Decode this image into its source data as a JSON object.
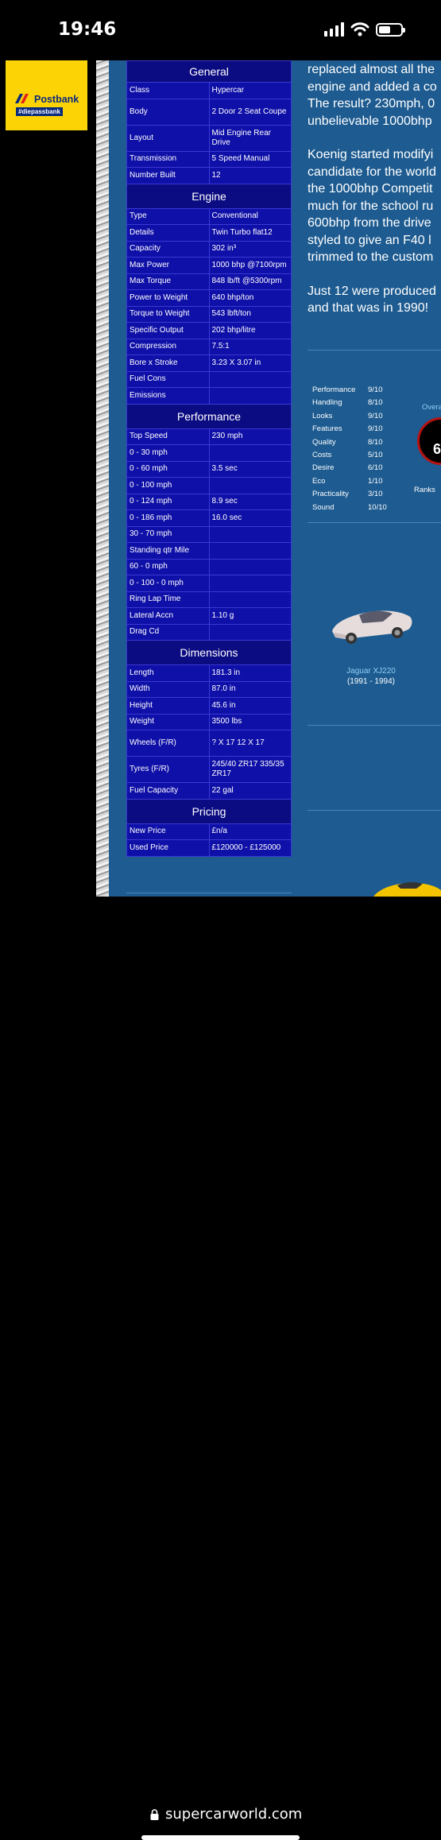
{
  "status": {
    "time": "19:46"
  },
  "ad": {
    "brand": "Postbank",
    "tagline": "#diepassbank"
  },
  "spec_sections": [
    {
      "title": "General",
      "rows": [
        [
          "Class",
          "Hypercar"
        ],
        [
          "Body",
          "2 Door 2 Seat Coupe"
        ],
        [
          "Layout",
          "Mid Engine Rear Drive"
        ],
        [
          "Transmission",
          "5 Speed Manual"
        ],
        [
          "Number Built",
          "12"
        ]
      ]
    },
    {
      "title": "Engine",
      "rows": [
        [
          "Type",
          "Conventional"
        ],
        [
          "Details",
          "Twin Turbo flat12"
        ],
        [
          "Capacity",
          "302 in³"
        ],
        [
          "Max Power",
          "1000 bhp @7100rpm"
        ],
        [
          "Max Torque",
          "848 lb/ft @5300rpm"
        ],
        [
          "Power to Weight",
          "640 bhp/ton"
        ],
        [
          "Torque to Weight",
          "543 lbft/ton"
        ],
        [
          "Specific Output",
          "202 bhp/litre"
        ],
        [
          "Compression",
          "7.5:1"
        ],
        [
          "Bore x Stroke",
          "3.23 X 3.07 in"
        ],
        [
          "Fuel Cons",
          ""
        ],
        [
          "Emissions",
          ""
        ]
      ]
    },
    {
      "title": "Performance",
      "rows": [
        [
          "Top Speed",
          "230 mph"
        ],
        [
          "0 - 30 mph",
          ""
        ],
        [
          "0 - 60 mph",
          "3.5 sec"
        ],
        [
          "0 - 100 mph",
          ""
        ],
        [
          "0 - 124 mph",
          "8.9 sec"
        ],
        [
          "0 - 186 mph",
          "16.0 sec"
        ],
        [
          "30 - 70 mph",
          ""
        ],
        [
          "Standing qtr Mile",
          ""
        ],
        [
          "60 - 0 mph",
          ""
        ],
        [
          "0 - 100 - 0 mph",
          ""
        ],
        [
          "Ring Lap Time",
          ""
        ],
        [
          "Lateral Accn",
          "1.10 g"
        ],
        [
          "Drag Cd",
          ""
        ]
      ]
    },
    {
      "title": "Dimensions",
      "rows": [
        [
          "Length",
          "181.3 in"
        ],
        [
          "Width",
          "87.0 in"
        ],
        [
          "Height",
          "45.6 in"
        ],
        [
          "Weight",
          "3500 lbs"
        ],
        [
          "Wheels (F/R)",
          "? X 17 12 X 17"
        ],
        [
          "Tyres (F/R)",
          "245/40 ZR17 335/35 ZR17"
        ],
        [
          "Fuel Capacity",
          "22 gal"
        ]
      ]
    },
    {
      "title": "Pricing",
      "rows": [
        [
          "New Price",
          "£n/a"
        ],
        [
          "Used Price",
          "£120000 - £125000"
        ]
      ]
    }
  ],
  "article": {
    "lines_p1": [
      "replaced almost all the",
      "engine and added a co",
      "The result? 230mph, 0",
      "unbelievable 1000bhp"
    ],
    "lines_p2": [
      "Koenig started modifyi",
      "candidate for the world",
      "the 1000bhp Competit",
      "much for the school ru",
      "600bhp from the drive",
      "styled to give an F40 l",
      "trimmed to the custom"
    ],
    "lines_p3": [
      "Just 12 were produced",
      "and that was in 1990!"
    ]
  },
  "ratings": [
    [
      "Performance",
      "9/10"
    ],
    [
      "Handling",
      "8/10"
    ],
    [
      "Looks",
      "9/10"
    ],
    [
      "Features",
      "9/10"
    ],
    [
      "Quality",
      "8/10"
    ],
    [
      "Costs",
      "5/10"
    ],
    [
      "Desire",
      "6/10"
    ],
    [
      "Eco",
      "1/10"
    ],
    [
      "Practicality",
      "3/10"
    ],
    [
      "Sound",
      "10/10"
    ]
  ],
  "overall": {
    "label": "Overa",
    "value": "6",
    "ranks": "Ranks"
  },
  "related_car": {
    "name": "Jaguar XJ220",
    "years": "(1991 - 1994)"
  },
  "browser": {
    "url": "supercarworld.com"
  }
}
